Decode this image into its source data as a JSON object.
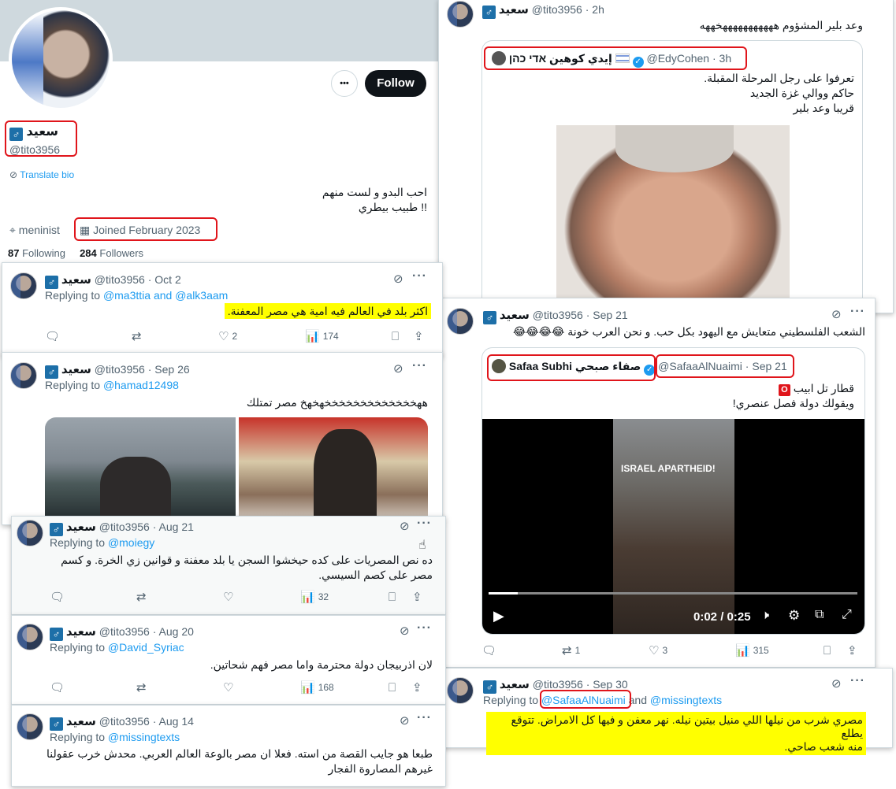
{
  "profile": {
    "name": "سعيد",
    "handle": "@tito3956",
    "translate_bio": "Translate bio",
    "bio_line1": "احب البدو و لست منهم",
    "bio_line2": "!! طبيب بيطري",
    "location": "meninist",
    "joined": "Joined February 2023",
    "following_count": "87",
    "following_label": "Following",
    "followers_count": "284",
    "followers_label": "Followers",
    "follow_button": "Follow",
    "more_button": "•••"
  },
  "colors": {
    "accent": "#1d9bf0",
    "highlight": "#ffff00",
    "annotation": "#e0151b"
  },
  "tweets": [
    {
      "name": "سعيد",
      "handle": "@tito3956",
      "time": "Oct 2",
      "replying_label": "Replying to",
      "replying_to": "@ma3ttia and @alk3aam",
      "text": "اكثر بلد في العالم فيه امية هي مصر المعفنة.",
      "likes": "2",
      "views": "174"
    },
    {
      "name": "سعيد",
      "handle": "@tito3956",
      "time": "Sep 26",
      "replying_label": "Replying to",
      "replying_to": "@hamad12498",
      "text": "ههخخخخخخخخخخخخخهخهخ مصر تمتلك"
    },
    {
      "name": "سعيد",
      "handle": "@tito3956",
      "time": "Aug 21",
      "replying_label": "Replying to",
      "replying_to": "@moiegy",
      "text_line1": "ده نص المصريات على كده حيخشوا السجن يا بلد معفنة و قوانين زي الخرة. و كسم",
      "text_line2": "مصر على كصم السيسي.",
      "views": "32"
    },
    {
      "name": "سعيد",
      "handle": "@tito3956",
      "time": "Aug 20",
      "replying_label": "Replying to",
      "replying_to": "@David_Syriac",
      "text": "لان اذربيجان دولة محترمة واما مصر فهم شحاتين.",
      "views": "168"
    },
    {
      "name": "سعيد",
      "handle": "@tito3956",
      "time": "Aug 14",
      "replying_label": "Replying to",
      "replying_to": "@missingtexts",
      "text_line1": "طبعا هو جايب القصة من استه. فعلا ان مصر بالوعة العالم العربي. محدش خرب عقولنا",
      "text_line2": "غيرهم المصاروة الفجار"
    }
  ],
  "right_tweet1": {
    "name": "سعيد",
    "handle": "@tito3956",
    "time": "2h",
    "text": "وعد بلير المشؤوم هههههههههههخههه",
    "quote_name": "إيدي كوهين אדי כהן",
    "quote_handle": "@EdyCohen",
    "quote_time": "3h",
    "quote_line1": "تعرفوا على رجل المرحلة المقبلة.",
    "quote_line2": "حاكم ووالي غزة الجديد",
    "quote_line3": "قريبا وعد بلير"
  },
  "right_tweet2": {
    "name": "سعيد",
    "handle": "@tito3956",
    "time": "Sep 21",
    "text": "الشعب الفلسطيني متعايش مع اليهود بكل حب. و نحن العرب خونة 😂😂😂😂",
    "quote_name": "Safaa Subhi صفاء صبحي",
    "quote_handle": "@SafaaAlNuaimi",
    "quote_time": "Sep 21",
    "quote_line1": "قطار تل ابيب",
    "quote_line2": "ويقولك دولة فصل عنصري!",
    "video_caption": "ISRAEL APARTHEID!",
    "video_time": "0:02 / 0:25",
    "video_progress": 0.08,
    "retweets": "1",
    "likes": "3",
    "views": "315"
  },
  "right_tweet3": {
    "name": "سعيد",
    "handle": "@tito3956",
    "time": "Sep 30",
    "replying_label": "Replying to",
    "replying_to": "@SafaaAlNuaimi",
    "and_label": "and",
    "replying_to2": "@missingtexts",
    "text_line1": "مصري شرب من نيلها اللي منيل بيتين نيله. نهر معفن و فيها كل الامراض. تتوقع يطلع",
    "text_line2": "منه شعب صاحي."
  }
}
